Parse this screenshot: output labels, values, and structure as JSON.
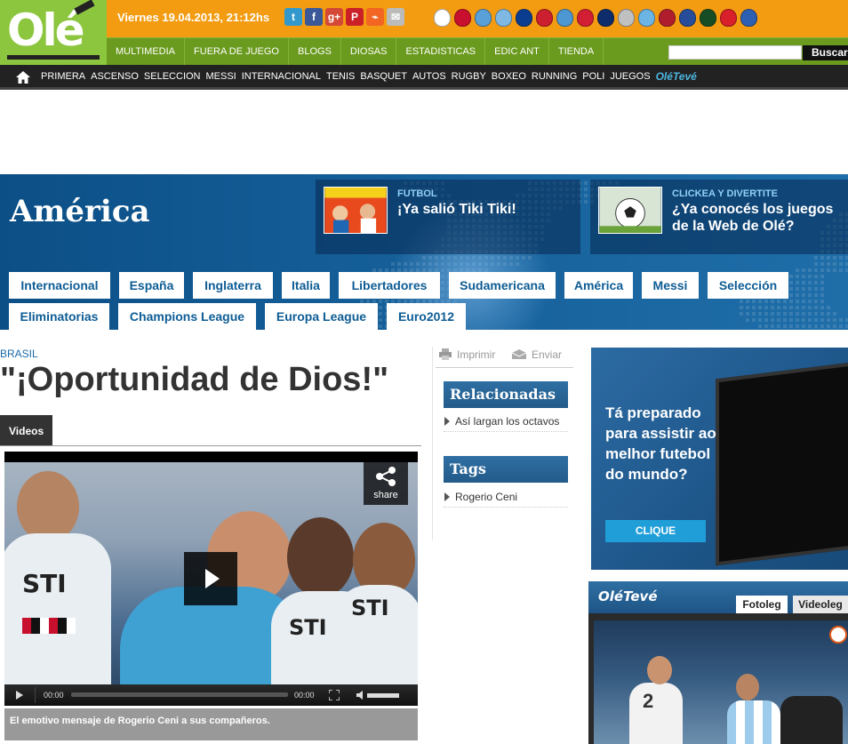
{
  "header": {
    "logo_text": "Olé",
    "date": "Viernes 19.04.2013, 21:12hs",
    "social": [
      {
        "icon": "twitter-icon",
        "glyph": "t",
        "color": "#3399cc"
      },
      {
        "icon": "facebook-icon",
        "glyph": "f",
        "color": "#3b5998"
      },
      {
        "icon": "google-plus-icon",
        "glyph": "g+",
        "color": "#d34836"
      },
      {
        "icon": "pinterest-icon",
        "glyph": "P",
        "color": "#cb2027"
      },
      {
        "icon": "rss-icon",
        "glyph": "⌁",
        "color": "#f26522"
      },
      {
        "icon": "mail-icon",
        "glyph": "✉",
        "color": "#bbbbbb"
      }
    ],
    "club_colors": [
      "#ffffff",
      "#c8102e",
      "#5aa0d8",
      "#7fb9e3",
      "#0a3d8f",
      "#cc1f2f",
      "#4d97d2",
      "#d21f34",
      "#0e2c6b",
      "#c0c0c0",
      "#6cb4e4",
      "#b01e2e",
      "#274c9a",
      "#174d24",
      "#d81f2a",
      "#2d5fb3"
    ],
    "nav1": [
      "MULTIMEDIA",
      "FUERA DE JUEGO",
      "BLOGS",
      "DIOSAS",
      "ESTADISTICAS",
      "EDIC ANT",
      "TIENDA"
    ],
    "search_button": "Buscar",
    "nav2": [
      "PRIMERA",
      "ASCENSO",
      "SELECCION",
      "MESSI",
      "INTERNACIONAL",
      "TENIS",
      "BASQUET",
      "AUTOS",
      "RUGBY",
      "BOXEO",
      "RUNNING",
      "POLI",
      "JUEGOS"
    ],
    "nav2_brand": "OléTevé"
  },
  "banner": {
    "section_title": "América",
    "promo1": {
      "kicker": "FUTBOL",
      "title": "¡Ya salió Tiki Tiki!"
    },
    "promo2": {
      "kicker": "CLICKEA Y DIVERTITE",
      "title": "¿Ya conocés los juegos de la Web de Olé?"
    },
    "tags_row1": [
      "Internacional",
      "España",
      "Inglaterra",
      "Italia",
      "Libertadores",
      "Sudamericana",
      "América",
      "Messi",
      "Selección"
    ],
    "tags_row2": [
      "Eliminatorias",
      "Champions League",
      "Europa League",
      "Euro2012"
    ]
  },
  "article": {
    "kicker": "BRASIL",
    "headline": "\"¡Oportunidad de Dios!\"",
    "tab": "Videos",
    "share_label": "share",
    "time_current": "00:00",
    "time_total": "00:00",
    "caption": "El emotivo mensaje de Rogerio Ceni a sus compañeros.",
    "shirt_text": "STI"
  },
  "tools": {
    "print": "Imprimir",
    "send": "Enviar"
  },
  "related": {
    "title": "Relacionadas",
    "items": [
      "Así largan los octavos"
    ]
  },
  "tags_box": {
    "title": "Tags",
    "items": [
      "Rogerio Ceni"
    ]
  },
  "ad": {
    "text": "Tá preparado para assistir ao melhor futebol do mundo?",
    "button": "CLIQUE"
  },
  "olet_widget": {
    "logo": "OléTevé",
    "tabs": [
      "Fotoleg",
      "Videoleg"
    ],
    "jersey_number": "2"
  }
}
